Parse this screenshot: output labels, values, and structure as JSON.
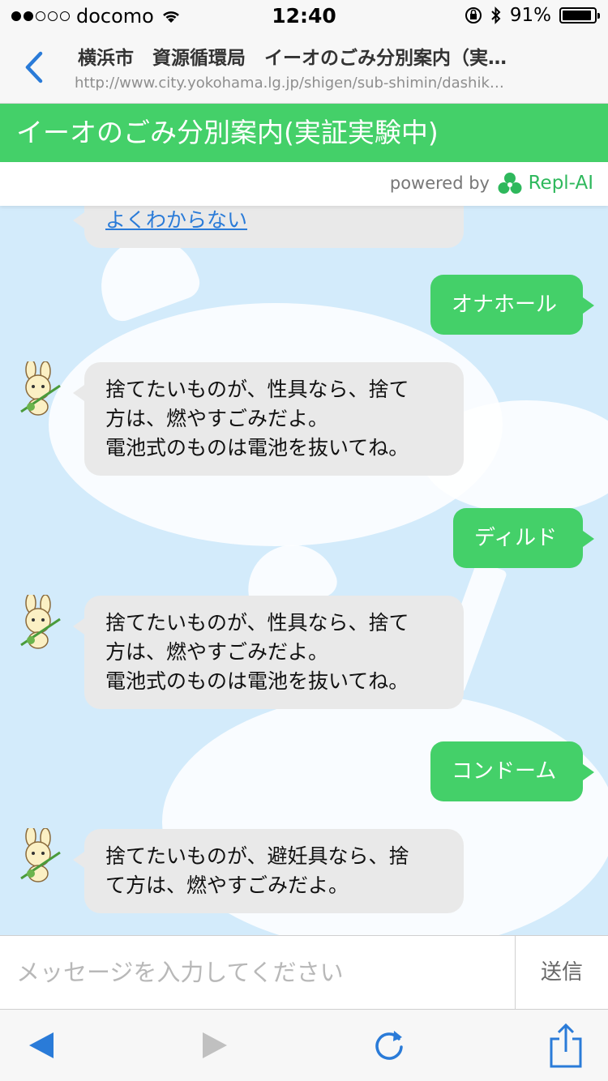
{
  "status": {
    "carrier": "docomo",
    "time": "12:40",
    "battery": "91%",
    "battery_level": 0.91,
    "signal_bars_filled": 2,
    "signal_bars_total": 5
  },
  "nav": {
    "title": "横浜市　資源循環局　イーオのごみ分別案内（実…",
    "url": "http://www.city.yokohama.lg.jp/shigen/sub-shimin/dashik…"
  },
  "header": {
    "title": "イーオのごみ分別案内(実証実験中)",
    "accent": "#44d069"
  },
  "powered": {
    "text": "powered by",
    "brand": "Repl-AI"
  },
  "chat": {
    "messages": [
      {
        "from": "bot",
        "text": "よくわからない",
        "link": true
      },
      {
        "from": "user",
        "text": "オナホール"
      },
      {
        "from": "bot",
        "lines": [
          "捨てたいものが、性具なら、捨て",
          "方は、燃やすごみだよ。",
          "電池式のものは電池を抜いてね。"
        ]
      },
      {
        "from": "user",
        "text": "ディルド"
      },
      {
        "from": "bot",
        "lines": [
          "捨てたいものが、性具なら、捨て",
          "方は、燃やすごみだよ。",
          "電池式のものは電池を抜いてね。"
        ]
      },
      {
        "from": "user",
        "text": "コンドーム"
      },
      {
        "from": "bot",
        "lines": [
          "捨てたいものが、避妊具なら、捨",
          "て方は、燃やすごみだよ。"
        ]
      }
    ]
  },
  "input": {
    "placeholder": "メッセージを入力してください",
    "send_label": "送信"
  },
  "toolbar": {
    "icons": [
      "back-arrow-icon",
      "forward-arrow-icon",
      "reload-icon",
      "share-icon"
    ]
  }
}
